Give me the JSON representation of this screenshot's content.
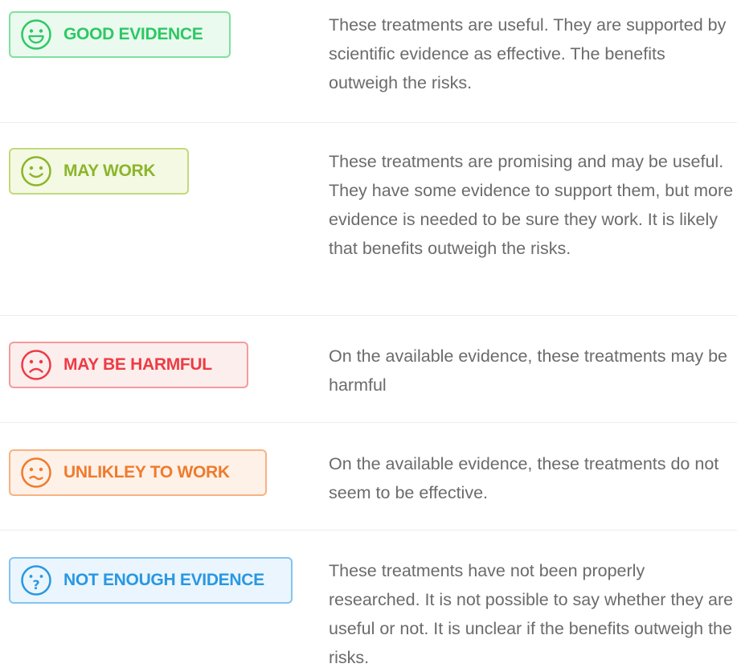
{
  "items": [
    {
      "label": "GOOD EVIDENCE",
      "icon": "grinning-face-icon",
      "description": "These treatments are useful. They are supported by scientific evidence as effective. The benefits outweigh the risks."
    },
    {
      "label": "MAY WORK",
      "icon": "smiling-face-icon",
      "description": "These treatments are promising and may be useful. They have some evidence to support them, but more evidence is needed to be sure they work. It is likely that benefits outweigh the risks."
    },
    {
      "label": "MAY BE HARMFUL",
      "icon": "frowning-face-icon",
      "description": "On the available evidence, these treatments may be harmful"
    },
    {
      "label": "UNLIKLEY TO WORK",
      "icon": "wavy-mouth-face-icon",
      "description": "On the available evidence, these treatments do not seem to be effective."
    },
    {
      "label": "NOT ENOUGH EVIDENCE",
      "icon": "question-face-icon",
      "description": "These treatments have not been properly researched. It is not possible to say whether they are useful or not. It is unclear if the benefits outweigh the risks."
    }
  ],
  "colors": {
    "good": "#2cc963",
    "may_work": "#8cb52c",
    "may_be_harmful": "#ee3b43",
    "unlikely": "#f07a2d",
    "not_enough": "#2898e2",
    "text": "#6b6b6b"
  }
}
